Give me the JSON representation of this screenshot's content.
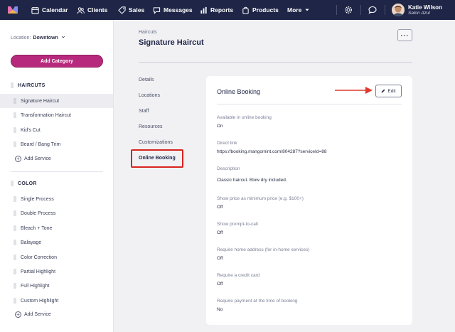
{
  "nav": {
    "items": [
      {
        "label": "Calendar",
        "icon": "calendar-icon"
      },
      {
        "label": "Clients",
        "icon": "clients-icon"
      },
      {
        "label": "Sales",
        "icon": "tag-icon"
      },
      {
        "label": "Messages",
        "icon": "chat-icon"
      },
      {
        "label": "Reports",
        "icon": "bar-chart-icon"
      },
      {
        "label": "Products",
        "icon": "bag-icon"
      },
      {
        "label": "More",
        "icon": "chevron-down-icon"
      }
    ],
    "user_name": "Katie Wilson",
    "user_salon": "Salon Azul"
  },
  "sidebar": {
    "location_label": "Location:",
    "location_value": "Downtown",
    "add_category": "Add Category",
    "categories": [
      {
        "name": "HAIRCUTS",
        "services": [
          "Signature Haircut",
          "Transformation Haircut",
          "Kid's Cut",
          "Beard / Bang Trim"
        ],
        "add_service": "Add Service"
      },
      {
        "name": "COLOR",
        "services": [
          "Single Process",
          "Double Process",
          "Bleach + Tone",
          "Balayage",
          "Color Correction",
          "Partial Highlight",
          "Full Highlight",
          "Custom Highlight"
        ],
        "add_service": "Add Service"
      }
    ]
  },
  "main": {
    "breadcrumb": "Haircuts",
    "title": "Signature Haircut",
    "more_label": "···",
    "subnav": [
      "Details",
      "Locations",
      "Staff",
      "Resources",
      "Customizations",
      "Online Booking"
    ],
    "active_subnav": "Online Booking"
  },
  "card": {
    "title": "Online Booking",
    "edit_label": "Edit",
    "fields": [
      {
        "label": "Available in online booking",
        "value": "On"
      },
      {
        "label": "Direct link",
        "value": "https://booking.mangomint.com/804287?serviceId=88"
      },
      {
        "label": "Description",
        "value": "Classic haircut. Blow dry included."
      },
      {
        "label": "Show price as minimum price (e.g. $100+)",
        "value": "Off"
      },
      {
        "label": "Show prompt-to-call",
        "value": "Off"
      },
      {
        "label": "Require home address (for in-home services)",
        "value": "Off"
      },
      {
        "label": "Require a credit card",
        "value": "Off"
      },
      {
        "label": "Require payment at the time of booking",
        "value": "No"
      }
    ]
  },
  "colors": {
    "nav_bg": "#1e2546",
    "accent": "#b7297c",
    "highlight": "#d9231f",
    "link": "#4a5bd6"
  }
}
